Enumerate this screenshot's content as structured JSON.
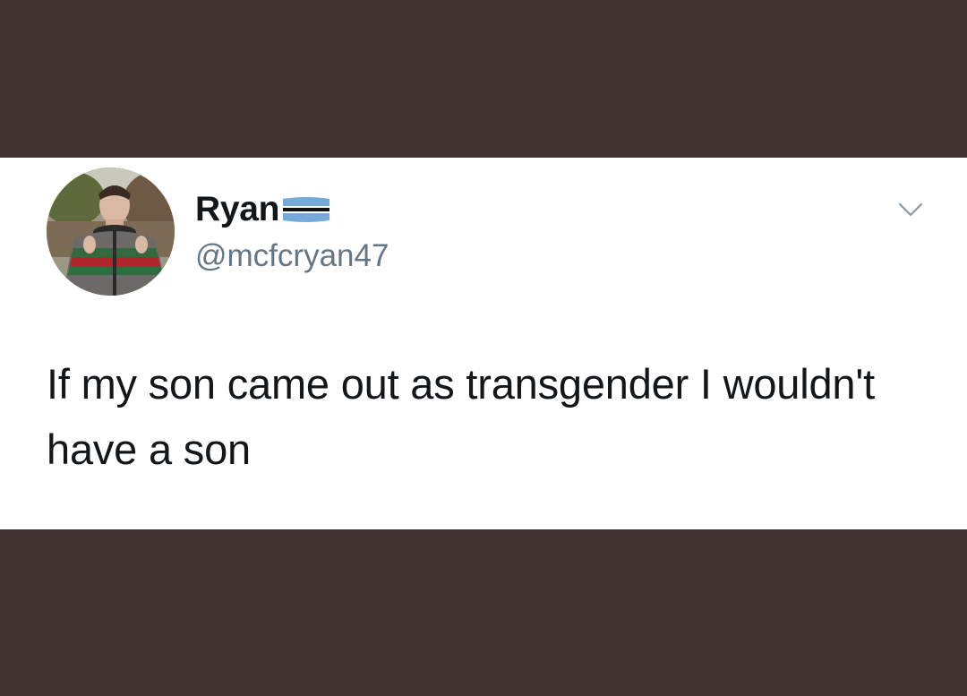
{
  "tweet": {
    "display_name": "Ryan",
    "handle": "@mcfcryan47",
    "text": "If my son came out as transgender I wouldn't have a son"
  },
  "icons": {
    "flag": "botswana-flag-icon",
    "menu": "chevron-down-icon"
  },
  "colors": {
    "background": "#3f3230",
    "card": "#ffffff",
    "name_text": "#14171a",
    "handle_text": "#657786",
    "chevron": "#8899a6"
  }
}
